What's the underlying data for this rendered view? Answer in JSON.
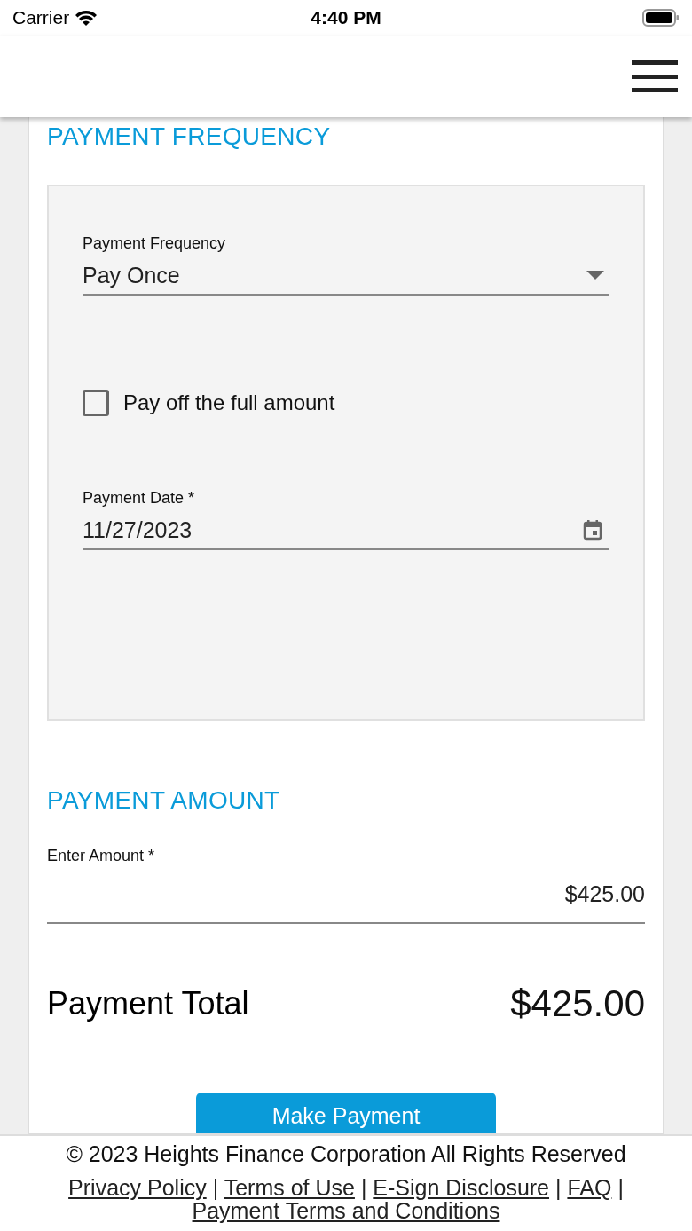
{
  "status_bar": {
    "carrier": "Carrier",
    "time": "4:40 PM"
  },
  "frequency_section": {
    "title": "PAYMENT FREQUENCY",
    "frequency_field": {
      "label": "Payment Frequency",
      "value": "Pay Once"
    },
    "pay_full": {
      "label": "Pay off the full amount",
      "checked": false
    },
    "date_field": {
      "label": "Payment Date *",
      "value": "11/27/2023"
    }
  },
  "amount_section": {
    "title": "PAYMENT AMOUNT",
    "amount_field": {
      "label": "Enter Amount *",
      "value": "$425.00"
    }
  },
  "total": {
    "label": "Payment Total",
    "value": "$425.00"
  },
  "submit_button": "Make Payment",
  "footer": {
    "copyright": "© 2023 Heights Finance Corporation  All Rights Reserved",
    "separator": "|",
    "links": [
      "Privacy Policy",
      "Terms of Use",
      "E-Sign Disclosure",
      "FAQ",
      "Payment Terms and Conditions"
    ]
  }
}
